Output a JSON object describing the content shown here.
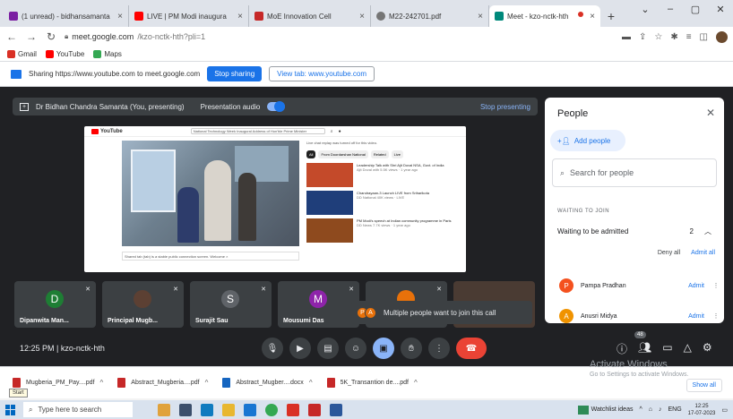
{
  "browser": {
    "tabs": [
      {
        "title": "(1 unread) - bidhansamanta",
        "color": "#7b1fa2"
      },
      {
        "title": "LIVE | PM Modi inaugura",
        "color": "#ff0000"
      },
      {
        "title": "MoE Innovation Cell",
        "color": "#c62828"
      },
      {
        "title": "M22-242701.pdf",
        "color": "#757575"
      },
      {
        "title": "Meet - kzo-nctk-hth",
        "color": "#00897b"
      }
    ],
    "new_tab": "+",
    "url_host": "meet.google.com",
    "url_path": "/kzo-nctk-hth?pli=1",
    "bookmarks": [
      {
        "label": "Gmail",
        "color": "#d93025"
      },
      {
        "label": "YouTube",
        "color": "#ff0000"
      },
      {
        "label": "Maps",
        "color": "#34a853"
      }
    ]
  },
  "sharing_bar": {
    "text": "Sharing https://www.youtube.com to meet.google.com",
    "stop_sharing": "Stop sharing",
    "view_tab": "View tab: www.youtube.com"
  },
  "meet": {
    "presenter_text": "Dr Bidhan Chandra Samanta (You, presenting)",
    "presentation_audio": "Presentation audio",
    "stop_presenting": "Stop presenting",
    "youtube": {
      "logo": "YouTube",
      "search_text": "National Technology Week Inaugural Address of Hon'ble Prime Minister",
      "video_caption": "Shared tab (tab) is a stable public connection screen. Welcome ×",
      "side_header": "Live chat replay was turned off for this video.",
      "chips": [
        "All",
        "From Doordarshan National",
        "Related",
        "Live"
      ],
      "recommendations": [
        {
          "title": "Leadership Talk with Shri Ajit Doval NSA, Govt. of India",
          "meta": "Ajit Doval with\n5.5K views · 1 year ago",
          "color": "#c44a2a"
        },
        {
          "title": "Chandrayaan-3 Launch LIVE from Sriharikota",
          "meta": "DD National\n40K views · LIVE",
          "color": "#1f3e7a"
        },
        {
          "title": "PM Modi's speech at Indian community programme in Paris",
          "meta": "DD News\n7.7K views · 1 year ago",
          "color": "#8e4a1e"
        }
      ]
    },
    "participants": [
      {
        "name": "Dipanwita Man...",
        "initial": "D",
        "color": "#1e7e34"
      },
      {
        "name": "Principal Mugb...",
        "initial": "",
        "color": "#5c4033"
      },
      {
        "name": "Surajit Sau",
        "initial": "S",
        "color": "#5f6368"
      },
      {
        "name": "Mousumi Das",
        "initial": "M",
        "color": "#8e24aa"
      },
      {
        "name": "",
        "initial": "",
        "color": "#e8710a"
      },
      {
        "name": "",
        "initial": "",
        "color": "#4a3b33"
      }
    ],
    "toast": {
      "text": "Multiple people want to join this call",
      "avatar_initials": [
        "P",
        "A"
      ]
    },
    "time": "12:25 PM",
    "meeting_code": "kzo-nctk-hth",
    "participant_count": "48"
  },
  "people_panel": {
    "title": "People",
    "add_people": "Add people",
    "search_placeholder": "Search for people",
    "waiting_label": "WAITING TO JOIN",
    "waiting_row": "Waiting to be admitted",
    "waiting_count": "2",
    "deny_all": "Deny all",
    "admit_all": "Admit all",
    "waiting_people": [
      {
        "name": "Pampa Pradhan",
        "initial": "P",
        "color": "#f4511e",
        "action": "Admit"
      },
      {
        "name": "Anusri Midya",
        "initial": "A",
        "color": "#f09300",
        "action": "Admit"
      }
    ]
  },
  "downloads": [
    {
      "name": "Mugberia_PM_Pay....pdf",
      "color": "#c62828"
    },
    {
      "name": "Abstract_Mugberia....pdf",
      "color": "#c62828"
    },
    {
      "name": "Abstract_Mugber....docx",
      "color": "#1565c0"
    },
    {
      "name": "5K_Transantion de....pdf",
      "color": "#c62828"
    }
  ],
  "show_all": "Show all",
  "watermark": {
    "line1": "Activate Windows",
    "line2": "Go to Settings to activate Windows."
  },
  "start_tooltip": "Start",
  "taskbar": {
    "search_placeholder": "Type here to search",
    "watchlist": "Watchlist ideas",
    "lang": "ENG",
    "clock_time": "12:25",
    "clock_date": "17-07-2023"
  }
}
